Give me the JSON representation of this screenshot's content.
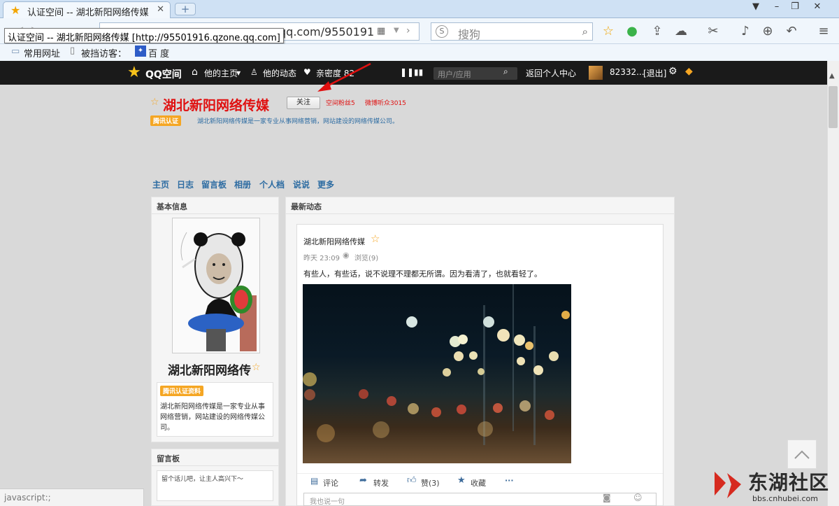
{
  "browser": {
    "tab_title": "认证空间 -- 湖北新阳网络传媒",
    "tab_close": "✕",
    "new_tab": "+",
    "url_visible": "qq.com/9550191",
    "tooltip": "认证空间 -- 湖北新阳网络传媒 [http://95501916.qzone.qq.com]",
    "search_placeholder": "搜狗",
    "search_engine_icon": "S",
    "bookmarks": [
      "常用网址",
      "被挡访客：",
      "百 度"
    ],
    "status_text": "javascript:;"
  },
  "qzone_bar": {
    "logo": "QQ空间",
    "his_home": "他的主页",
    "his_feed": "他的动态",
    "intimacy": "亲密度 82",
    "search_placeholder": "用户/应用",
    "back_home": "返回个人中心",
    "user": "82332...",
    "logout": "[退出]"
  },
  "header": {
    "space_name": "湖北新阳网络传媒",
    "follow": "关注",
    "fans_label": "空间粉丝5",
    "weibo_label": "微博听众3015",
    "cert_badge": "腾讯认证",
    "description": "湖北新阳网络传媒是一家专业从事网络营销，网站建设的网络传媒公司。"
  },
  "nav": [
    "主页",
    "日志",
    "留言板",
    "相册",
    "个人档",
    "说说",
    "更多"
  ],
  "profile": {
    "panel_title": "基本信息",
    "name": "湖北新阳网络传",
    "cert_badge": "腾讯认证资料",
    "intro": "湖北新阳网络传媒是一家专业从事网络营销，网站建设的网络传媒公司。"
  },
  "guestbook": {
    "panel_title": "留言板",
    "placeholder": "留个话儿吧，让主人高兴下～"
  },
  "feed": {
    "panel_title": "最新动态",
    "author": "湖北新阳网络传媒",
    "time": "昨天 23:09",
    "views": "浏览(9)",
    "text": "有些人，有些话，说不说理不理都无所谓。因为看清了，也就看轻了。",
    "actions": {
      "comment": "评论",
      "forward": "转发",
      "like": "赞(3)",
      "favorite": "收藏",
      "more": "···"
    },
    "comment_placeholder": "我也说一句"
  },
  "watermark": {
    "brand": "东湖社区",
    "url": "bbs.cnhubei.com"
  },
  "colors": {
    "brand_red": "#e01010",
    "link_blue": "#2d6ca2",
    "badge_orange": "#f5a623",
    "qzone_bar": "#1a1a1a"
  }
}
